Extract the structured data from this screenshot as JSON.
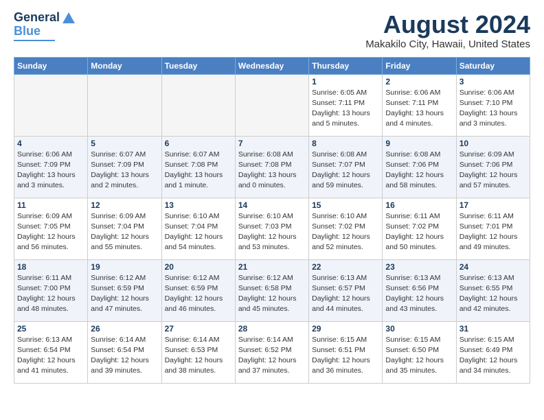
{
  "header": {
    "logo_line1": "General",
    "logo_line2": "Blue",
    "main_title": "August 2024",
    "subtitle": "Makakilo City, Hawaii, United States"
  },
  "calendar": {
    "days_of_week": [
      "Sunday",
      "Monday",
      "Tuesday",
      "Wednesday",
      "Thursday",
      "Friday",
      "Saturday"
    ],
    "weeks": [
      [
        {
          "day": "",
          "info": ""
        },
        {
          "day": "",
          "info": ""
        },
        {
          "day": "",
          "info": ""
        },
        {
          "day": "",
          "info": ""
        },
        {
          "day": "1",
          "info": "Sunrise: 6:05 AM\nSunset: 7:11 PM\nDaylight: 13 hours\nand 5 minutes."
        },
        {
          "day": "2",
          "info": "Sunrise: 6:06 AM\nSunset: 7:11 PM\nDaylight: 13 hours\nand 4 minutes."
        },
        {
          "day": "3",
          "info": "Sunrise: 6:06 AM\nSunset: 7:10 PM\nDaylight: 13 hours\nand 3 minutes."
        }
      ],
      [
        {
          "day": "4",
          "info": "Sunrise: 6:06 AM\nSunset: 7:09 PM\nDaylight: 13 hours\nand 3 minutes."
        },
        {
          "day": "5",
          "info": "Sunrise: 6:07 AM\nSunset: 7:09 PM\nDaylight: 13 hours\nand 2 minutes."
        },
        {
          "day": "6",
          "info": "Sunrise: 6:07 AM\nSunset: 7:08 PM\nDaylight: 13 hours\nand 1 minute."
        },
        {
          "day": "7",
          "info": "Sunrise: 6:08 AM\nSunset: 7:08 PM\nDaylight: 13 hours\nand 0 minutes."
        },
        {
          "day": "8",
          "info": "Sunrise: 6:08 AM\nSunset: 7:07 PM\nDaylight: 12 hours\nand 59 minutes."
        },
        {
          "day": "9",
          "info": "Sunrise: 6:08 AM\nSunset: 7:06 PM\nDaylight: 12 hours\nand 58 minutes."
        },
        {
          "day": "10",
          "info": "Sunrise: 6:09 AM\nSunset: 7:06 PM\nDaylight: 12 hours\nand 57 minutes."
        }
      ],
      [
        {
          "day": "11",
          "info": "Sunrise: 6:09 AM\nSunset: 7:05 PM\nDaylight: 12 hours\nand 56 minutes."
        },
        {
          "day": "12",
          "info": "Sunrise: 6:09 AM\nSunset: 7:04 PM\nDaylight: 12 hours\nand 55 minutes."
        },
        {
          "day": "13",
          "info": "Sunrise: 6:10 AM\nSunset: 7:04 PM\nDaylight: 12 hours\nand 54 minutes."
        },
        {
          "day": "14",
          "info": "Sunrise: 6:10 AM\nSunset: 7:03 PM\nDaylight: 12 hours\nand 53 minutes."
        },
        {
          "day": "15",
          "info": "Sunrise: 6:10 AM\nSunset: 7:02 PM\nDaylight: 12 hours\nand 52 minutes."
        },
        {
          "day": "16",
          "info": "Sunrise: 6:11 AM\nSunset: 7:02 PM\nDaylight: 12 hours\nand 50 minutes."
        },
        {
          "day": "17",
          "info": "Sunrise: 6:11 AM\nSunset: 7:01 PM\nDaylight: 12 hours\nand 49 minutes."
        }
      ],
      [
        {
          "day": "18",
          "info": "Sunrise: 6:11 AM\nSunset: 7:00 PM\nDaylight: 12 hours\nand 48 minutes."
        },
        {
          "day": "19",
          "info": "Sunrise: 6:12 AM\nSunset: 6:59 PM\nDaylight: 12 hours\nand 47 minutes."
        },
        {
          "day": "20",
          "info": "Sunrise: 6:12 AM\nSunset: 6:59 PM\nDaylight: 12 hours\nand 46 minutes."
        },
        {
          "day": "21",
          "info": "Sunrise: 6:12 AM\nSunset: 6:58 PM\nDaylight: 12 hours\nand 45 minutes."
        },
        {
          "day": "22",
          "info": "Sunrise: 6:13 AM\nSunset: 6:57 PM\nDaylight: 12 hours\nand 44 minutes."
        },
        {
          "day": "23",
          "info": "Sunrise: 6:13 AM\nSunset: 6:56 PM\nDaylight: 12 hours\nand 43 minutes."
        },
        {
          "day": "24",
          "info": "Sunrise: 6:13 AM\nSunset: 6:55 PM\nDaylight: 12 hours\nand 42 minutes."
        }
      ],
      [
        {
          "day": "25",
          "info": "Sunrise: 6:13 AM\nSunset: 6:54 PM\nDaylight: 12 hours\nand 41 minutes."
        },
        {
          "day": "26",
          "info": "Sunrise: 6:14 AM\nSunset: 6:54 PM\nDaylight: 12 hours\nand 39 minutes."
        },
        {
          "day": "27",
          "info": "Sunrise: 6:14 AM\nSunset: 6:53 PM\nDaylight: 12 hours\nand 38 minutes."
        },
        {
          "day": "28",
          "info": "Sunrise: 6:14 AM\nSunset: 6:52 PM\nDaylight: 12 hours\nand 37 minutes."
        },
        {
          "day": "29",
          "info": "Sunrise: 6:15 AM\nSunset: 6:51 PM\nDaylight: 12 hours\nand 36 minutes."
        },
        {
          "day": "30",
          "info": "Sunrise: 6:15 AM\nSunset: 6:50 PM\nDaylight: 12 hours\nand 35 minutes."
        },
        {
          "day": "31",
          "info": "Sunrise: 6:15 AM\nSunset: 6:49 PM\nDaylight: 12 hours\nand 34 minutes."
        }
      ]
    ]
  }
}
